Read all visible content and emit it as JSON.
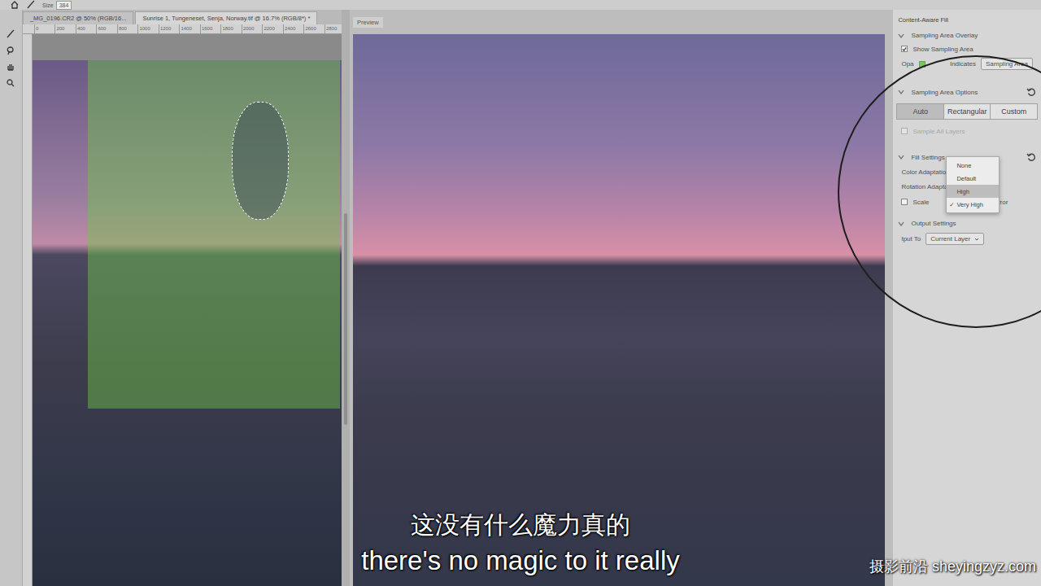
{
  "options_bar": {
    "size_label": "Size",
    "size_value": "384"
  },
  "tabs": [
    {
      "label": "_MG_0196.CR2 @ 50% (RGB/16...",
      "selected": false
    },
    {
      "label": "Sunrise 1, Tungeneset, Senja, Norway.tif @ 16.7% (RGB/8*) *",
      "selected": true
    }
  ],
  "ruler_ticks": [
    "0",
    "200",
    "400",
    "600",
    "800",
    "1000",
    "1200",
    "1400",
    "1600",
    "1800",
    "2000",
    "2200",
    "2400",
    "2600",
    "2800"
  ],
  "preview": {
    "label": "Preview"
  },
  "panel": {
    "title": "Content-Aware Fill",
    "overlay_section": {
      "title": "Sampling Area Overlay",
      "expanded": true,
      "show_sampling_area": {
        "label": "Show Sampling Area",
        "checked": true
      },
      "opacity_label": "Opa",
      "indicates_label": "Indicates",
      "indicates_value": "Sampling Area"
    },
    "sampling_section": {
      "title": "Sampling Area Options",
      "expanded": true,
      "modes": [
        {
          "label": "Auto",
          "selected": true
        },
        {
          "label": "Rectangular",
          "selected": false
        },
        {
          "label": "Custom",
          "selected": false
        }
      ],
      "sample_all_layers": {
        "label": "Sample All Layers",
        "checked": false,
        "disabled": true
      }
    },
    "fill_section": {
      "title": "Fill Settings",
      "expanded": true,
      "color_adaptation_label": "Color Adaptation",
      "rotation_adaptation": {
        "label": "Rotation Adaptation",
        "value": "None"
      },
      "scale": {
        "label": "Scale",
        "checked": false
      },
      "mirror": {
        "label": "Mirror",
        "checked": false
      }
    },
    "output_section": {
      "title": "Output Settings",
      "expanded": true,
      "output_to": {
        "label": "tput To",
        "value": "Current Layer"
      }
    }
  },
  "dropdown": {
    "check": "✓",
    "options": [
      {
        "label": "None",
        "selected": false,
        "hovered": false
      },
      {
        "label": "Default",
        "selected": false,
        "hovered": false
      },
      {
        "label": "High",
        "selected": false,
        "hovered": true
      },
      {
        "label": "Very High",
        "selected": true,
        "hovered": false
      }
    ]
  },
  "subtitles": {
    "chinese": "这没有什么魔力真的",
    "english": "there's no magic to it really"
  },
  "watermark": "摄影前沿 sheyingzyz.com"
}
